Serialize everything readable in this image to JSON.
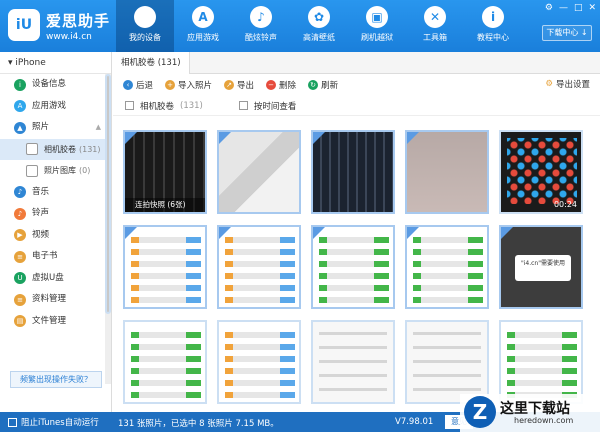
{
  "header": {
    "logo_text": "iU",
    "brand_name": "爱思助手",
    "brand_url": "www.i4.cn",
    "nav": [
      {
        "label": "我的设备",
        "icon": "apple-icon",
        "glyph": ""
      },
      {
        "label": "应用游戏",
        "icon": "app-store-icon",
        "glyph": "A"
      },
      {
        "label": "酷炫铃声",
        "icon": "bell-icon",
        "glyph": "♪"
      },
      {
        "label": "高清壁纸",
        "icon": "flower-icon",
        "glyph": "✿"
      },
      {
        "label": "刷机越狱",
        "icon": "box-icon",
        "glyph": "▣"
      },
      {
        "label": "工具箱",
        "icon": "tools-icon",
        "glyph": "✕"
      },
      {
        "label": "教程中心",
        "icon": "info-icon",
        "glyph": "i"
      }
    ],
    "window_controls": [
      "⚙",
      "—",
      "□",
      "✕"
    ],
    "download_label": "下载中心 ↓"
  },
  "sidebar": {
    "device": "iPhone",
    "items": [
      {
        "label": "设备信息",
        "color": "#1aa260",
        "glyph": "i",
        "sub": false
      },
      {
        "label": "应用游戏",
        "color": "#2fa7ec",
        "glyph": "A",
        "sub": false
      },
      {
        "label": "照片",
        "color": "#2f86d4",
        "glyph": "▲",
        "sub": false,
        "caret": "▲"
      },
      {
        "label": "相机胶卷",
        "count": "(131)",
        "sub": true,
        "selected": true
      },
      {
        "label": "照片图库",
        "count": "(0)",
        "sub": true
      },
      {
        "label": "音乐",
        "color": "#2f86d4",
        "glyph": "♪",
        "sub": false
      },
      {
        "label": "铃声",
        "color": "#f17a3a",
        "glyph": "♪",
        "sub": false
      },
      {
        "label": "视频",
        "color": "#e6a23b",
        "glyph": "▶",
        "sub": false
      },
      {
        "label": "电子书",
        "color": "#e6a23b",
        "glyph": "≡",
        "sub": false
      },
      {
        "label": "虚拟U盘",
        "color": "#1aa260",
        "glyph": "U",
        "sub": false
      },
      {
        "label": "资料管理",
        "color": "#e6a23b",
        "glyph": "≡",
        "sub": false
      },
      {
        "label": "文件管理",
        "color": "#e6a23b",
        "glyph": "▤",
        "sub": false
      }
    ],
    "help_button": "频繁出现操作失败？"
  },
  "content": {
    "tab": "相机胶卷 (131)",
    "toolbar": [
      {
        "label": "后退",
        "icon": "back-icon",
        "color": "#2f86d4",
        "glyph": "‹"
      },
      {
        "label": "导入照片",
        "icon": "import-icon",
        "color": "#e6a23b",
        "glyph": "+"
      },
      {
        "label": "导出",
        "icon": "export-icon",
        "color": "#e6a23b",
        "glyph": "↗"
      },
      {
        "label": "删除",
        "icon": "delete-icon",
        "color": "#e64b3c",
        "glyph": "−"
      },
      {
        "label": "刷新",
        "icon": "refresh-icon",
        "color": "#1aa260",
        "glyph": "↻"
      }
    ],
    "settings_label": "导出设置",
    "filter": {
      "album_label": "相机胶卷",
      "album_count": "(131)",
      "by_time_label": "按时间查看"
    },
    "thumbs": [
      {
        "style": "keyboard",
        "label": "连拍快照 (6张)",
        "checked": true
      },
      {
        "style": "kb2",
        "checked": true
      },
      {
        "style": "kb3",
        "checked": true
      },
      {
        "style": "blur",
        "checked": true
      },
      {
        "style": "phone",
        "duration": "00:24",
        "checked": false
      },
      {
        "style": "shot",
        "checked": true
      },
      {
        "style": "shot",
        "checked": true
      },
      {
        "style": "shot green",
        "checked": true
      },
      {
        "style": "shot green",
        "checked": true
      },
      {
        "style": "dark",
        "checked": true,
        "dialog": "\"i4.cn\"需要使用"
      },
      {
        "style": "shot green",
        "checked": false
      },
      {
        "style": "shot",
        "checked": false
      },
      {
        "style": "plain",
        "checked": false
      },
      {
        "style": "plain",
        "checked": false
      },
      {
        "style": "shot green",
        "checked": false
      }
    ]
  },
  "status": {
    "itunes_label": "阻止iTunes自动运行",
    "info": "131 张照片，已选中 8 张照片 7.15 MB。",
    "version": "V7.98.01",
    "feedback": "意见"
  },
  "watermark": {
    "text": "这里下载站",
    "url": "heredown.com"
  }
}
